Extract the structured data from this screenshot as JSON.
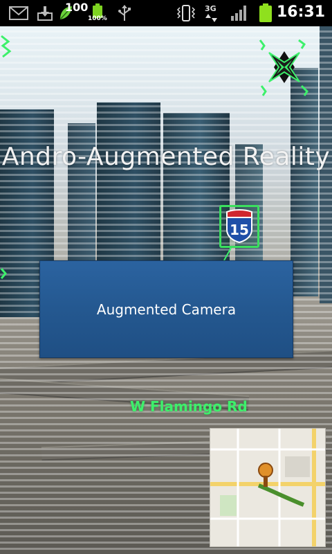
{
  "status_bar": {
    "battery_level_text": "100",
    "battery_percent_text": "100%",
    "network_type": "3G",
    "time": "16:31",
    "icons": [
      "gmail-icon",
      "download-icon",
      "leaf-icon",
      "battery-icon",
      "usb-icon",
      "vibrate-icon",
      "network-3g-icon",
      "signal-icon",
      "battery-full-icon"
    ]
  },
  "app": {
    "title": "Andro-Augmented Reality",
    "camera_button_label": "Augmented Camera"
  },
  "ar_overlay": {
    "street_label": "W Flamingo Rd",
    "interstate_sign_number": "15"
  },
  "colors": {
    "button_blue": "#245890",
    "overlay_green": "#3df06b",
    "status_bar_bg": "#000000"
  }
}
